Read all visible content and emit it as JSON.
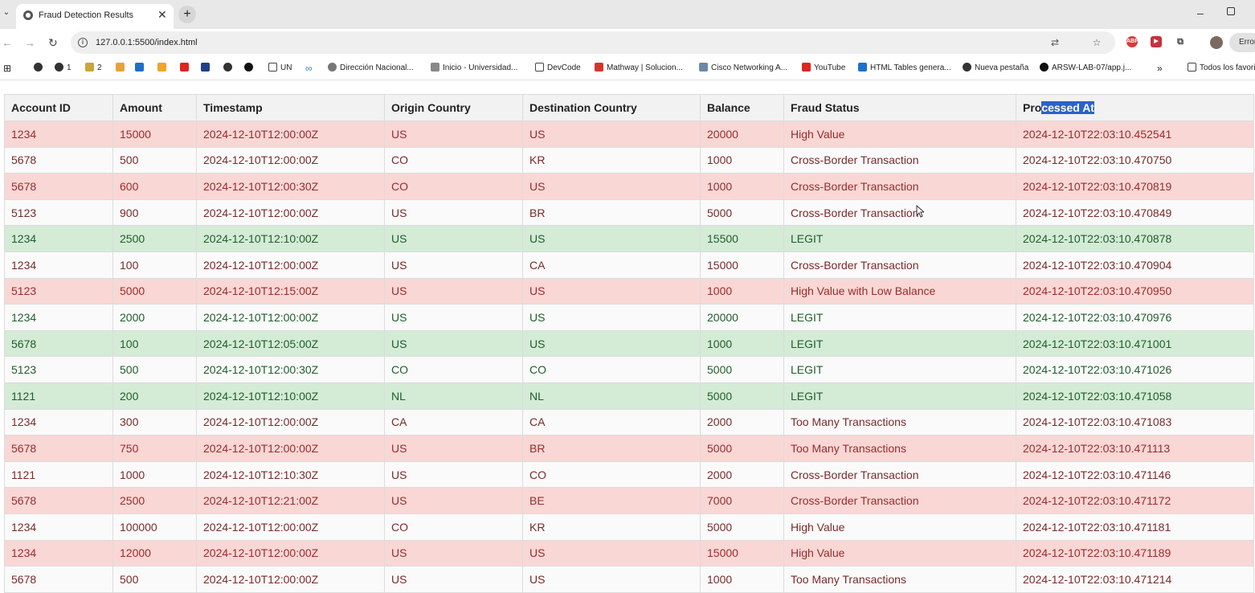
{
  "browser": {
    "tab_title": "Fraud Detection Results",
    "url": "127.0.0.1:5500/index.html",
    "profile_error_label": "Error"
  },
  "bookmarks": [
    {
      "label": "",
      "icon": "github-circle-icon"
    },
    {
      "label": "1",
      "icon": "github-circle-icon"
    },
    {
      "label": "2",
      "icon": "chart-icon"
    },
    {
      "label": "",
      "icon": "generic-site-icon"
    },
    {
      "label": "",
      "icon": "outlook-icon"
    },
    {
      "label": "",
      "icon": "microsoft-icon"
    },
    {
      "label": "",
      "icon": "youtube-icon"
    },
    {
      "label": "",
      "icon": "vscode-icon"
    },
    {
      "label": "",
      "icon": "github-circle-icon"
    },
    {
      "label": "",
      "icon": "github-icon"
    },
    {
      "label": "UN",
      "icon": "folder-icon"
    },
    {
      "label": "",
      "icon": "infinity-icon"
    },
    {
      "label": "Dirección Nacional...",
      "icon": "globe-icon"
    },
    {
      "label": "Inicio - Universidad...",
      "icon": "university-icon"
    },
    {
      "label": "DevCode",
      "icon": "folder-icon"
    },
    {
      "label": "Mathway | Solucion...",
      "icon": "mathway-icon"
    },
    {
      "label": "Cisco Networking A...",
      "icon": "cisco-icon"
    },
    {
      "label": "YouTube",
      "icon": "youtube-icon"
    },
    {
      "label": "HTML Tables genera...",
      "icon": "table-icon"
    },
    {
      "label": "Nueva pestaña",
      "icon": "chrome-icon"
    },
    {
      "label": "ARSW-LAB-07/app.j...",
      "icon": "github-icon"
    },
    {
      "label": "Todos los favoritos",
      "icon": "folder-icon"
    }
  ],
  "table": {
    "columns": [
      "Account ID",
      "Amount",
      "Timestamp",
      "Origin Country",
      "Destination Country",
      "Balance",
      "Fraud Status",
      "Processed At"
    ],
    "rows": [
      {
        "style": "fraud",
        "cells": [
          "1234",
          "15000",
          "2024-12-10T12:00:00Z",
          "US",
          "US",
          "20000",
          "High Value",
          "2024-12-10T22:03:10.452541"
        ]
      },
      {
        "style": "plain-fraud",
        "cells": [
          "5678",
          "500",
          "2024-12-10T12:00:00Z",
          "CO",
          "KR",
          "1000",
          "Cross-Border Transaction",
          "2024-12-10T22:03:10.470750"
        ]
      },
      {
        "style": "fraud",
        "cells": [
          "5678",
          "600",
          "2024-12-10T12:00:30Z",
          "CO",
          "US",
          "1000",
          "Cross-Border Transaction",
          "2024-12-10T22:03:10.470819"
        ]
      },
      {
        "style": "plain-fraud",
        "cells": [
          "5123",
          "900",
          "2024-12-10T12:00:00Z",
          "US",
          "BR",
          "5000",
          "Cross-Border Transaction",
          "2024-12-10T22:03:10.470849"
        ]
      },
      {
        "style": "legit",
        "cells": [
          "1234",
          "2500",
          "2024-12-10T12:10:00Z",
          "US",
          "US",
          "15500",
          "LEGIT",
          "2024-12-10T22:03:10.470878"
        ]
      },
      {
        "style": "plain-fraud",
        "cells": [
          "1234",
          "100",
          "2024-12-10T12:00:00Z",
          "US",
          "CA",
          "15000",
          "Cross-Border Transaction",
          "2024-12-10T22:03:10.470904"
        ]
      },
      {
        "style": "fraud",
        "cells": [
          "5123",
          "5000",
          "2024-12-10T12:15:00Z",
          "US",
          "US",
          "1000",
          "High Value with Low Balance",
          "2024-12-10T22:03:10.470950"
        ]
      },
      {
        "style": "plain-legit",
        "cells": [
          "1234",
          "2000",
          "2024-12-10T12:00:00Z",
          "US",
          "US",
          "20000",
          "LEGIT",
          "2024-12-10T22:03:10.470976"
        ]
      },
      {
        "style": "legit",
        "cells": [
          "5678",
          "100",
          "2024-12-10T12:05:00Z",
          "US",
          "US",
          "1000",
          "LEGIT",
          "2024-12-10T22:03:10.471001"
        ]
      },
      {
        "style": "plain-legit",
        "cells": [
          "5123",
          "500",
          "2024-12-10T12:00:30Z",
          "CO",
          "CO",
          "5000",
          "LEGIT",
          "2024-12-10T22:03:10.471026"
        ]
      },
      {
        "style": "legit",
        "cells": [
          "1121",
          "200",
          "2024-12-10T12:10:00Z",
          "NL",
          "NL",
          "5000",
          "LEGIT",
          "2024-12-10T22:03:10.471058"
        ]
      },
      {
        "style": "plain-fraud",
        "cells": [
          "1234",
          "300",
          "2024-12-10T12:00:00Z",
          "CA",
          "CA",
          "2000",
          "Too Many Transactions",
          "2024-12-10T22:03:10.471083"
        ]
      },
      {
        "style": "fraud",
        "cells": [
          "5678",
          "750",
          "2024-12-10T12:00:00Z",
          "US",
          "BR",
          "5000",
          "Too Many Transactions",
          "2024-12-10T22:03:10.471113"
        ]
      },
      {
        "style": "plain-fraud",
        "cells": [
          "1121",
          "1000",
          "2024-12-10T12:10:30Z",
          "US",
          "CO",
          "2000",
          "Cross-Border Transaction",
          "2024-12-10T22:03:10.471146"
        ]
      },
      {
        "style": "fraud",
        "cells": [
          "5678",
          "2500",
          "2024-12-10T12:21:00Z",
          "US",
          "BE",
          "7000",
          "Cross-Border Transaction",
          "2024-12-10T22:03:10.471172"
        ]
      },
      {
        "style": "plain-fraud",
        "cells": [
          "1234",
          "100000",
          "2024-12-10T12:00:00Z",
          "CO",
          "KR",
          "5000",
          "High Value",
          "2024-12-10T22:03:10.471181"
        ]
      },
      {
        "style": "fraud",
        "cells": [
          "1234",
          "12000",
          "2024-12-10T12:00:00Z",
          "US",
          "US",
          "15000",
          "High Value",
          "2024-12-10T22:03:10.471189"
        ]
      },
      {
        "style": "plain-fraud",
        "cells": [
          "5678",
          "500",
          "2024-12-10T12:00:00Z",
          "US",
          "US",
          "1000",
          "Too Many Transactions",
          "2024-12-10T22:03:10.471214"
        ]
      }
    ]
  },
  "colors": {
    "fraud_row_bg": "#f9d7d5",
    "legit_row_bg": "#d4ebd6",
    "selection": "#2a63c9"
  }
}
